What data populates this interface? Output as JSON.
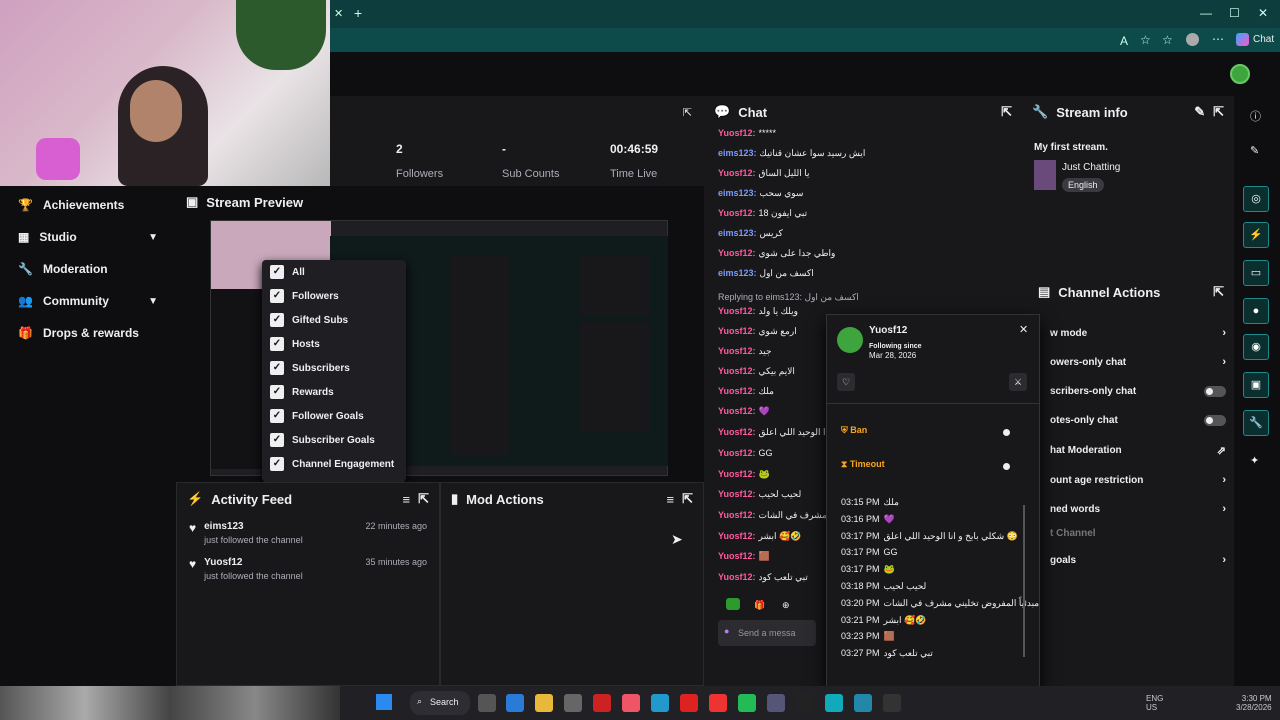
{
  "browser": {
    "new_tab": "+",
    "copilot_label": "Chat",
    "window_controls": [
      "—",
      "☐",
      "✕"
    ]
  },
  "sidebar": {
    "items": [
      {
        "label": "Achievements",
        "icon": "trophy-icon"
      },
      {
        "label": "Studio",
        "icon": "studio-icon",
        "expandable": true
      },
      {
        "label": "Moderation",
        "icon": "wrench-icon"
      },
      {
        "label": "Community",
        "icon": "users-icon",
        "expandable": true
      },
      {
        "label": "Drops & rewards",
        "icon": "gift-icon"
      }
    ]
  },
  "stats": [
    {
      "value": "2",
      "label": "Followers"
    },
    {
      "value": "-",
      "label": "Sub Counts"
    },
    {
      "value": "00:46:59",
      "label": "Time Live"
    }
  ],
  "preview": {
    "title": "Stream Preview"
  },
  "filter_menu": {
    "items": [
      "All",
      "Followers",
      "Gifted Subs",
      "Hosts",
      "Subscribers",
      "Rewards",
      "Follower Goals",
      "Subscriber Goals",
      "Channel Engagement"
    ]
  },
  "activity": {
    "title": "Activity Feed",
    "items": [
      {
        "name": "eims123",
        "action": "just followed the channel",
        "time": "22 minutes ago"
      },
      {
        "name": "Yuosf12",
        "action": "just followed the channel",
        "time": "35 minutes ago"
      }
    ]
  },
  "mod_actions": {
    "title": "Mod Actions"
  },
  "chat": {
    "title": "Chat",
    "messages": [
      {
        "user": "Yuosf12:",
        "text": "*****",
        "color": "pink"
      },
      {
        "user": "eims123:",
        "text": "ايش رسيد سوا عشان قناتيك",
        "color": "blue"
      },
      {
        "user": "Yuosf12:",
        "text": "يا الليل الساق",
        "color": "pink"
      },
      {
        "user": "eims123:",
        "text": "سوي سحب",
        "color": "blue"
      },
      {
        "user": "Yuosf12:",
        "text": "تبي ايفون 18",
        "color": "pink"
      },
      {
        "user": "eims123:",
        "text": "كريس",
        "color": "blue"
      },
      {
        "user": "Yuosf12:",
        "text": "واطي جدا على شوي",
        "color": "pink"
      },
      {
        "user": "eims123:",
        "text": "اكسف من اول",
        "color": "blue"
      },
      {
        "user": "Yuosf12:",
        "text": "ويلك يا ولد",
        "color": "pink"
      },
      {
        "user": "Yuosf12:",
        "text": "ارمع شوي",
        "color": "pink"
      },
      {
        "user": "Yuosf12:",
        "text": "جيد",
        "color": "pink"
      },
      {
        "user": "Yuosf12:",
        "text": "الايم بيكي",
        "color": "pink"
      },
      {
        "user": "Yuosf12:",
        "text": "ملك",
        "color": "pink"
      },
      {
        "user": "Yuosf12:",
        "text": "💜",
        "color": "pink"
      },
      {
        "user": "Yuosf12:",
        "text": "دا الوحيد اللي اعلق",
        "color": "pink"
      },
      {
        "user": "Yuosf12:",
        "text": "GG",
        "color": "pink"
      },
      {
        "user": "Yuosf12:",
        "text": "🐸",
        "color": "pink"
      },
      {
        "user": "Yuosf12:",
        "text": "لحيب لحيب",
        "color": "pink"
      },
      {
        "user": "Yuosf12:",
        "text": "مشرف في الشات",
        "color": "pink"
      },
      {
        "user": "Yuosf12:",
        "text": "ابشر 🥰🤣",
        "color": "pink"
      },
      {
        "user": "Yuosf12:",
        "text": "🟫",
        "color": "pink"
      },
      {
        "user": "Yuosf12:",
        "text": "تبي تلعب كود",
        "color": "pink"
      }
    ],
    "reply_hint": "Replying to eims123: اكسف من اول",
    "input_placeholder": "Send a messa"
  },
  "stream_info": {
    "title": "Stream info",
    "stream_title": "My first stream.",
    "category": "Just Chatting",
    "tag": "English"
  },
  "channel_actions": {
    "title": "Channel Actions",
    "items": [
      {
        "label": "w mode",
        "control": "chevron"
      },
      {
        "label": "owers-only chat",
        "control": "chevron"
      },
      {
        "label": "scribers-only chat",
        "control": "toggle"
      },
      {
        "label": "otes-only chat",
        "control": "toggle"
      },
      {
        "label": "hat Moderation",
        "control": "external"
      },
      {
        "label": "ount age restriction",
        "control": "chevron"
      },
      {
        "label": "ned words",
        "control": "chevron"
      },
      {
        "label": "t Channel",
        "control": "none"
      },
      {
        "label": "goals",
        "control": "chevron"
      }
    ]
  },
  "user_card": {
    "name": "Yuosf12",
    "following_label": "Following since",
    "following_date": "Mar 28, 2026",
    "ban_label": "Ban",
    "timeout_label": "Timeout",
    "log": [
      {
        "time": "03:15 PM",
        "text": "ملك"
      },
      {
        "time": "03:16 PM",
        "text": "💜"
      },
      {
        "time": "03:17 PM",
        "text": "شكلي بايخ و انا الوحيد اللي اعلق 😳"
      },
      {
        "time": "03:17 PM",
        "text": "GG"
      },
      {
        "time": "03:17 PM",
        "text": "🐸"
      },
      {
        "time": "03:18 PM",
        "text": "لحيب لحيب"
      },
      {
        "time": "03:20 PM",
        "text": "مبدئياً المفروض تخليني مشرف في الشات"
      },
      {
        "time": "03:21 PM",
        "text": "ابشر 🥰🤣"
      },
      {
        "time": "03:23 PM",
        "text": "🟫"
      },
      {
        "time": "03:27 PM",
        "text": "تبي تلعب كود"
      }
    ]
  },
  "taskbar": {
    "search_label": "Search",
    "lang": "ENG",
    "region": "US",
    "time": "3:30 PM",
    "date": "3/28/2026"
  }
}
